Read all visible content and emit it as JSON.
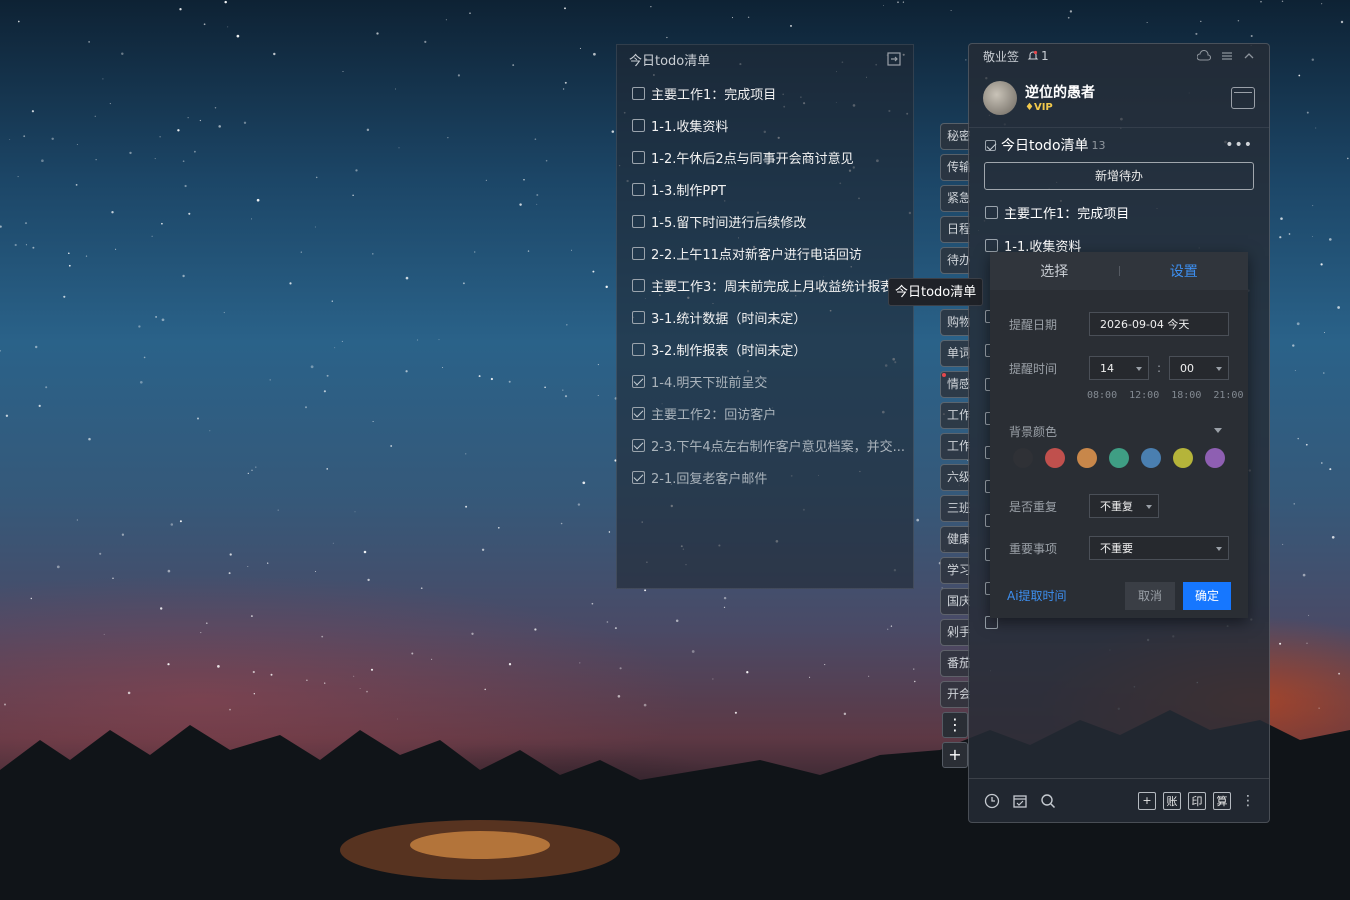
{
  "left_panel": {
    "title": "今日todo清单",
    "items": [
      {
        "text": "主要工作1：完成项目",
        "done": false
      },
      {
        "text": "1-1.收集资料",
        "done": false
      },
      {
        "text": "1-2.午休后2点与同事开会商讨意见",
        "done": false
      },
      {
        "text": "1-3.制作PPT",
        "done": false
      },
      {
        "text": "1-5.留下时间进行后续修改",
        "done": false
      },
      {
        "text": "2-2.上午11点对新客户进行电话回访",
        "done": false
      },
      {
        "text": "主要工作3：周末前完成上月收益统计报表",
        "done": false
      },
      {
        "text": "3-1.统计数据（时间未定）",
        "done": false
      },
      {
        "text": "3-2.制作报表（时间未定）",
        "done": false
      },
      {
        "text": "1-4.明天下班前呈交",
        "done": true
      },
      {
        "text": "主要工作2：回访客户",
        "done": true
      },
      {
        "text": "2-3.下午4点左右制作客户意见档案，并交...",
        "done": true
      },
      {
        "text": "2-1.回复老客户邮件",
        "done": true
      }
    ]
  },
  "tooltip": "今日todo清单",
  "side_tabs": [
    "秘密",
    "传输",
    "紧急",
    "日程",
    "待办",
    "",
    "购物",
    "单词",
    "情感",
    "工作",
    "工作",
    "六级",
    "三班",
    "健康",
    "学习",
    "国庆",
    "剁手",
    "番茄",
    "开会"
  ],
  "side_more": "⋮",
  "side_add": "+",
  "right_panel": {
    "app_name": "敬业签",
    "bell_count": "1",
    "user_name": "逆位的愚者",
    "vip": "VIP",
    "list_title": "今日todo清单",
    "list_count": "13",
    "more": "•••",
    "new_button": "新增待办",
    "items": [
      "主要工作1：完成项目",
      "1-1.收集资料"
    ],
    "footer_boxes": [
      "+",
      "账",
      "印",
      "算"
    ]
  },
  "popup": {
    "tab_select": "选择",
    "tab_settings": "设置",
    "date_label": "提醒日期",
    "date_value": "2026-09-04  今天",
    "time_label": "提醒时间",
    "hour": "14",
    "colon": ":",
    "minute": "00",
    "quick_times": "08:00 12:00 18:00 21:00",
    "bg_label": "背景颜色",
    "colors": [
      "#2f3136",
      "#c0504d",
      "#c8874a",
      "#3f9e84",
      "#4a7fb0",
      "#b5b43a",
      "#8e5fb2"
    ],
    "repeat_label": "是否重复",
    "repeat_value": "不重复",
    "important_label": "重要事项",
    "important_value": "不重要",
    "ai_link": "Ai提取时间",
    "cancel": "取消",
    "confirm": "确定"
  }
}
